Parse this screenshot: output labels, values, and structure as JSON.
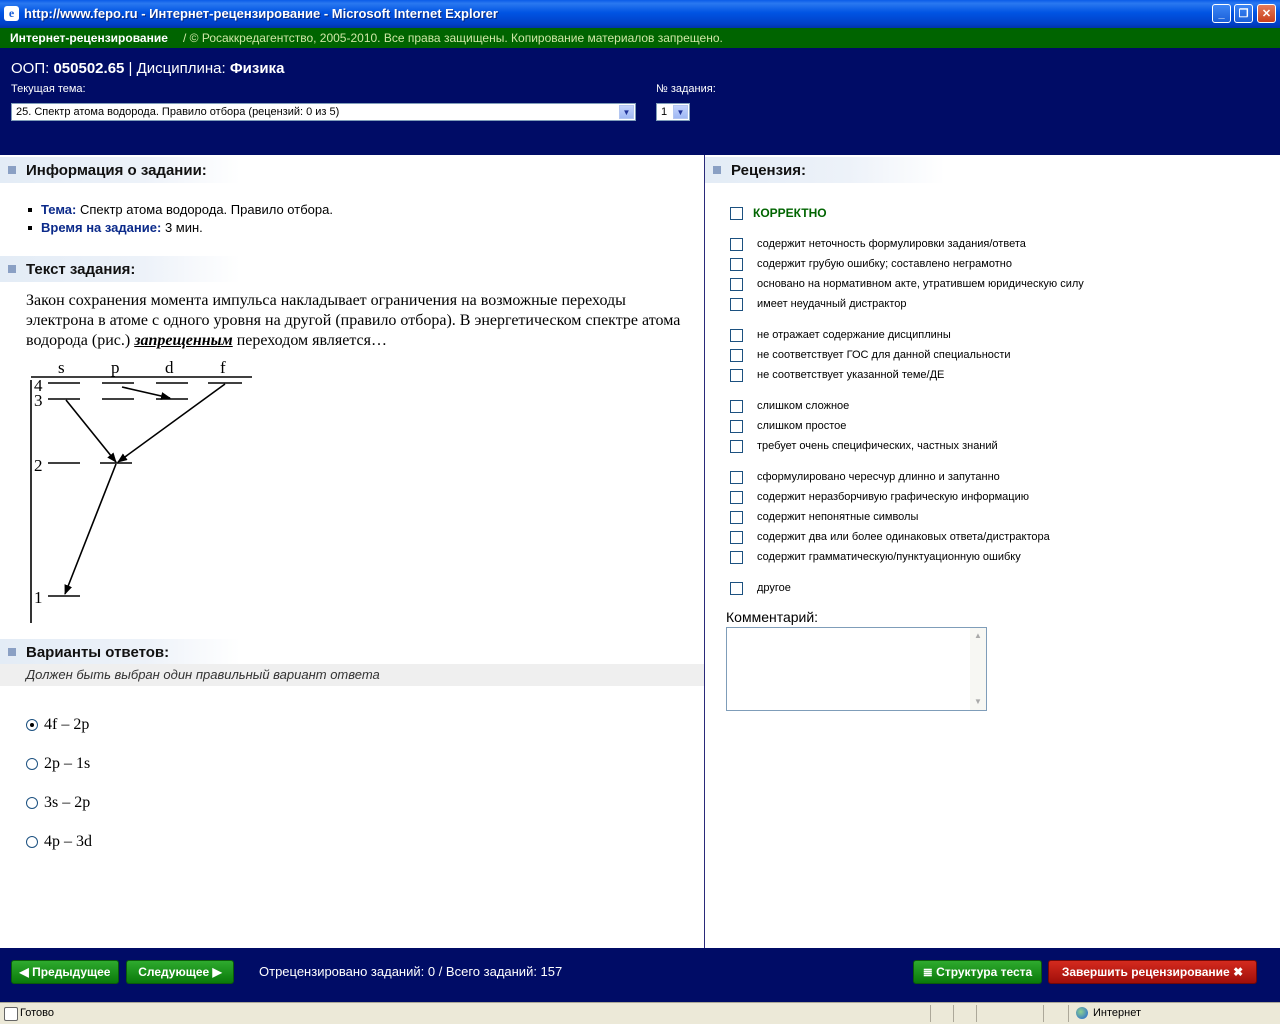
{
  "window": {
    "title": "http://www.fepo.ru - Интернет-рецензирование - Microsoft Internet Explorer"
  },
  "topbar": {
    "brand": "Интернет-рецензирование",
    "copyright": "/ © Росаккредагентство, 2005-2010. Все права защищены. Копирование материалов запрещено."
  },
  "header": {
    "oop_label": "ООП:",
    "oop_value": "050502.65",
    "separator": "|",
    "discipline_label": "Дисциплина:",
    "discipline_value": "Физика",
    "topic_label": "Текущая тема:",
    "topic_selected": "25. Спектр атома водорода. Правило отбора  (рецензий: 0 из 5)",
    "task_label": "№ задания:",
    "task_selected": "1"
  },
  "info": {
    "heading": "Информация о задании:",
    "topic_key": "Тема:",
    "topic_value": "Спектр атома водорода. Правило отбора.",
    "time_key": "Время на задание:",
    "time_value": "3 мин."
  },
  "task": {
    "heading": "Текст задания:",
    "text_before": "Закон сохранения момента импульса накладывает ограничения на возможные переходы электрона в атоме с одного уровня на другой (правило отбора). В энергетическом спектре атома водорода (рис.)",
    "emphasis": "запрещенным",
    "text_after": "переходом является…",
    "diagram": {
      "columns": [
        "s",
        "p",
        "d",
        "f"
      ],
      "levels": [
        "4",
        "3",
        "2",
        "1"
      ]
    }
  },
  "answers": {
    "heading": "Варианты ответов:",
    "note": "Должен быть выбран один правильный вариант ответа",
    "options": [
      {
        "label": "4f – 2p",
        "selected": true
      },
      {
        "label": "2p – 1s",
        "selected": false
      },
      {
        "label": "3s – 2p",
        "selected": false
      },
      {
        "label": "4p – 3d",
        "selected": false
      }
    ]
  },
  "review": {
    "heading": "Рецензия:",
    "correct_label": "КОРРЕКТНО",
    "criteria": [
      "содержит неточность формулировки задания/ответа",
      "содержит грубую ошибку; составлено неграмотно",
      "основано на нормативном акте, утратившем юридическую силу",
      "имеет неудачный дистрактор",
      "не отражает содержание дисциплины",
      "не соответствует ГОС для данной специальности",
      "не соответствует указанной теме/ДЕ",
      "слишком сложное",
      "слишком простое",
      "требует очень специфических, частных знаний",
      "сформулировано чересчур длинно и запутанно",
      "содержит неразборчивую графическую информацию",
      "содержит непонятные символы",
      "содержит два или более одинаковых ответа/дистрактора",
      "содержит грамматическую/пунктуационную ошибку",
      "другое"
    ],
    "comment_label": "Комментарий:",
    "comment_value": ""
  },
  "footer": {
    "prev_label": "Предыдущее",
    "next_label": "Следующее",
    "counts_text": "Отрецензировано заданий: 0 / Всего заданий:  157",
    "structure_label": "Структура теста",
    "finish_label": "Завершить рецензирование"
  },
  "statusbar": {
    "status": "Готово",
    "zone": "Интернет"
  }
}
